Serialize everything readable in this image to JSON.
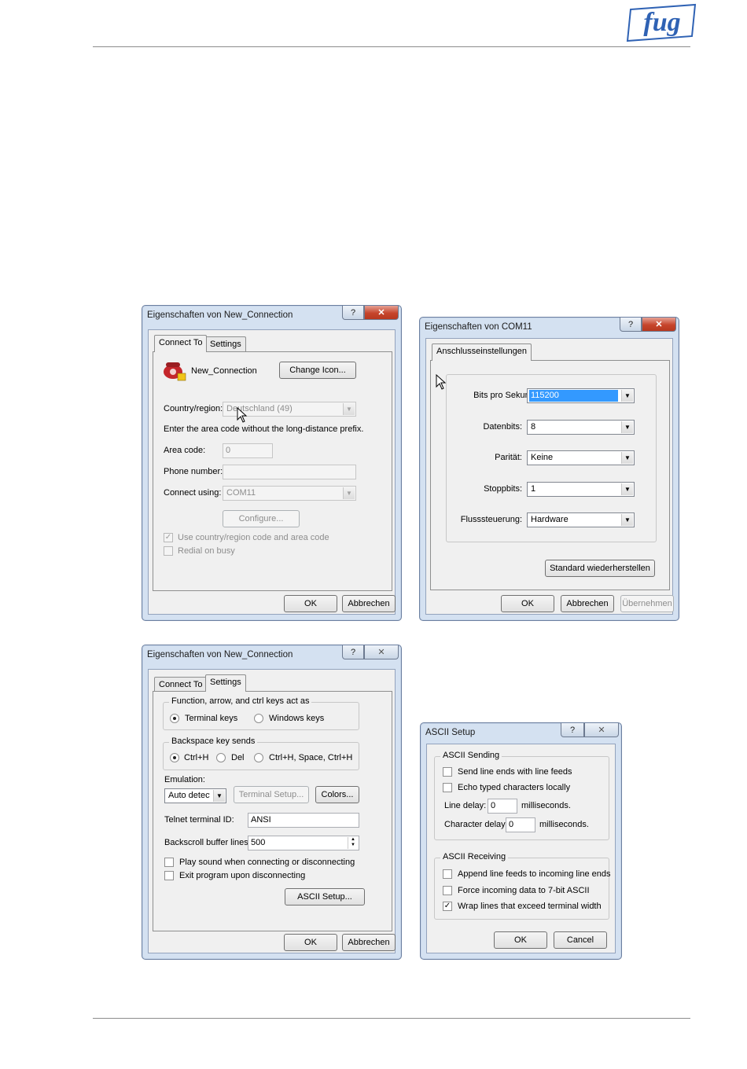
{
  "brand": {
    "logo_text": "fug"
  },
  "dialog_connection_connect_to": {
    "title": "Eigenschaften von New_Connection",
    "help_label": "?",
    "close_label": "✕",
    "tabs": [
      "Connect To",
      "Settings"
    ],
    "connection_name": "New_Connection",
    "change_icon_label": "Change Icon...",
    "country_label": "Country/region:",
    "country_value": "Deutschland (49)",
    "area_hint": "Enter the area code without the long-distance prefix.",
    "area_code_label": "Area code:",
    "area_code_value": "0",
    "phone_label": "Phone number:",
    "phone_value": "",
    "connect_using_label": "Connect using:",
    "connect_using_value": "COM11",
    "configure_label": "Configure...",
    "use_country_label": "Use country/region code and area code",
    "use_country_checked": true,
    "redial_label": "Redial on busy",
    "redial_checked": false,
    "ok_label": "OK",
    "cancel_label": "Abbrechen"
  },
  "dialog_com11": {
    "title": "Eigenschaften von COM11",
    "help_label": "?",
    "close_label": "✕",
    "tab": "Anschlusseinstellungen",
    "fields": [
      {
        "label": "Bits pro Sekunde:",
        "value": "115200"
      },
      {
        "label": "Datenbits:",
        "value": "8"
      },
      {
        "label": "Parität:",
        "value": "Keine"
      },
      {
        "label": "Stoppbits:",
        "value": "1"
      },
      {
        "label": "Flusssteuerung:",
        "value": "Hardware"
      }
    ],
    "restore_label": "Standard wiederherstellen",
    "ok_label": "OK",
    "cancel_label": "Abbrechen",
    "apply_label": "Übernehmen"
  },
  "dialog_connection_settings": {
    "title": "Eigenschaften von New_Connection",
    "help_label": "?",
    "close_label": "✕",
    "tabs": [
      "Connect To",
      "Settings"
    ],
    "function_keys_group": "Function, arrow, and ctrl keys act as",
    "terminal_keys_label": "Terminal keys",
    "windows_keys_label": "Windows keys",
    "backspace_group": "Backspace key sends",
    "ctrl_h_label": "Ctrl+H",
    "del_label": "Del",
    "ctrl_h_space_label": "Ctrl+H, Space, Ctrl+H",
    "emulation_label": "Emulation:",
    "emulation_value": "Auto detect",
    "terminal_setup_label": "Terminal Setup...",
    "colors_label": "Colors...",
    "telnet_id_label": "Telnet terminal ID:",
    "telnet_id_value": "ANSI",
    "backscroll_label": "Backscroll buffer lines:",
    "backscroll_value": "500",
    "play_sound_label": "Play sound when connecting or disconnecting",
    "exit_program_label": "Exit program upon disconnecting",
    "ascii_setup_label": "ASCII Setup...",
    "ok_label": "OK",
    "cancel_label": "Abbrechen"
  },
  "dialog_ascii": {
    "title": "ASCII Setup",
    "help_label": "?",
    "close_label": "✕",
    "sending_group": "ASCII Sending",
    "send_line_ends_label": "Send line ends with line feeds",
    "echo_label": "Echo typed characters locally",
    "line_delay_label": "Line delay:",
    "line_delay_value": "0",
    "line_delay_unit": "milliseconds.",
    "char_delay_label": "Character delay:",
    "char_delay_value": "0",
    "char_delay_unit": "milliseconds.",
    "receiving_group": "ASCII Receiving",
    "append_lf_label": "Append line feeds to incoming line ends",
    "force_7bit_label": "Force incoming data to 7-bit ASCII",
    "wrap_lines_label": "Wrap lines that exceed terminal width",
    "wrap_lines_checked": true,
    "ok_label": "OK",
    "cancel_label": "Cancel"
  },
  "colors": {
    "brand_blue": "#2f62b4",
    "selection": "#3399ff",
    "close_red": "#c6452c"
  }
}
